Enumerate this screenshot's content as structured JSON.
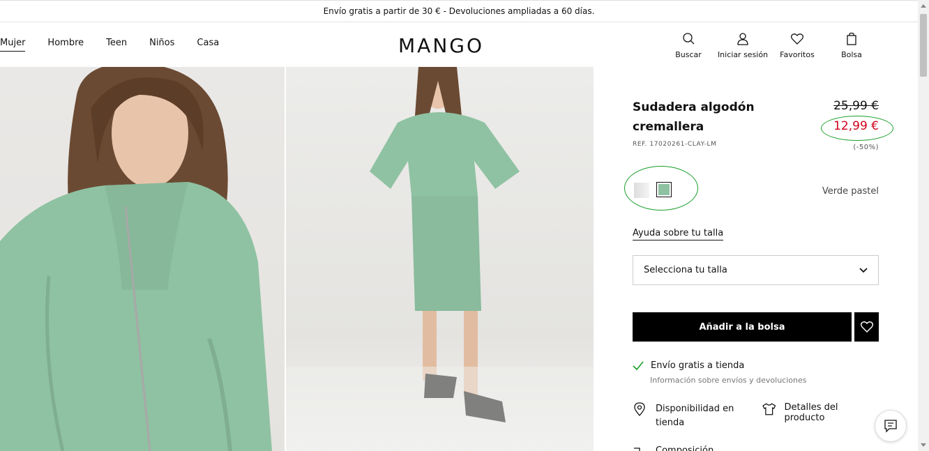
{
  "promo": {
    "text": "Envío gratis a partir de 30 € - Devoluciones ampliadas a 60 días."
  },
  "nav": {
    "items": [
      "Mujer",
      "Hombre",
      "Teen",
      "Niños",
      "Casa"
    ],
    "active": "Mujer"
  },
  "logo": "MANGO",
  "actions": {
    "search": "Buscar",
    "login": "Iniciar sesión",
    "favorites": "Favoritos",
    "bag": "Bolsa"
  },
  "product": {
    "title": "Sudadera algodón cremallera",
    "ref": "REF. 17020261-CLAY-LM",
    "old_price": "25,99 €",
    "new_price": "12,99 €",
    "discount": "(-50%)",
    "color_name": "Verde pastel",
    "colors": {
      "swatch_1": "#e8e8e8",
      "swatch_2": "#8fc2a2"
    },
    "size_help": "Ayuda sobre tu talla",
    "size_select": "Selecciona tu talla",
    "add_to_bag": "Añadir a la bolsa",
    "shipping": "Envío gratis a tienda",
    "shipping_sub": "Información sobre envíos y devoluciones",
    "availability": "Disponibilidad en tienda",
    "details": "Detalles del producto",
    "composition": "Composición"
  },
  "colors": {
    "price_red": "#d0021b",
    "highlight_green": "#1a9e2a",
    "garment": "#8fc2a2"
  }
}
